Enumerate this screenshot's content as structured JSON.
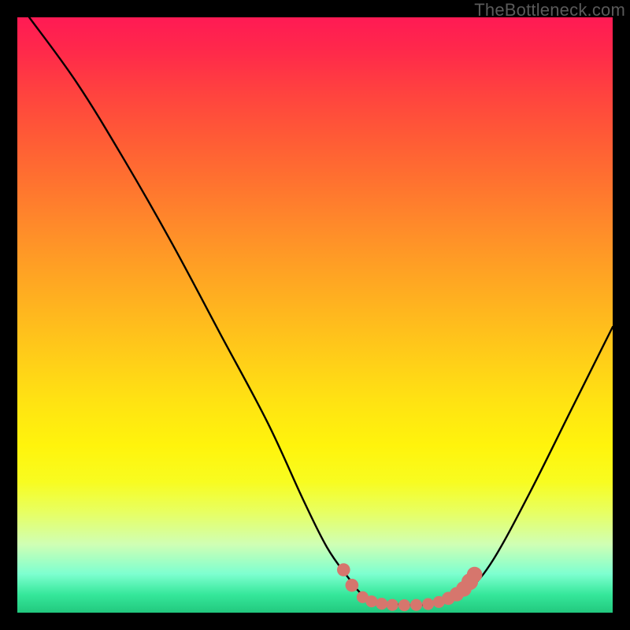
{
  "watermark": "TheBottleneck.com",
  "colors": {
    "background": "#000000",
    "curve_stroke": "#000000",
    "marker_fill": "#d6766d",
    "gradient_top": "#ff1a54",
    "gradient_bottom": "#22c87e"
  },
  "chart_data": {
    "type": "line",
    "title": "",
    "xlabel": "",
    "ylabel": "",
    "xlim": [
      0,
      100
    ],
    "ylim": [
      0,
      100
    ],
    "grid": false,
    "series": [
      {
        "name": "bottleneck-curve",
        "points": [
          {
            "x": 2,
            "y": 100
          },
          {
            "x": 10,
            "y": 89
          },
          {
            "x": 18,
            "y": 76
          },
          {
            "x": 26,
            "y": 62
          },
          {
            "x": 34,
            "y": 47
          },
          {
            "x": 42,
            "y": 32
          },
          {
            "x": 48,
            "y": 19
          },
          {
            "x": 52,
            "y": 11
          },
          {
            "x": 55.5,
            "y": 6
          },
          {
            "x": 58,
            "y": 3
          },
          {
            "x": 61,
            "y": 1.8
          },
          {
            "x": 65,
            "y": 1.3
          },
          {
            "x": 69,
            "y": 1.4
          },
          {
            "x": 73,
            "y": 2.4
          },
          {
            "x": 76,
            "y": 4
          },
          {
            "x": 80,
            "y": 9
          },
          {
            "x": 86,
            "y": 20
          },
          {
            "x": 93,
            "y": 34
          },
          {
            "x": 100,
            "y": 48
          }
        ]
      }
    ],
    "markers": [
      {
        "x": 54.8,
        "y": 7.2,
        "r": 1.1
      },
      {
        "x": 56.2,
        "y": 4.6,
        "r": 1.1
      },
      {
        "x": 58.0,
        "y": 2.6,
        "r": 1.0
      },
      {
        "x": 59.5,
        "y": 1.9,
        "r": 1.0
      },
      {
        "x": 61.2,
        "y": 1.5,
        "r": 1.0
      },
      {
        "x": 63.0,
        "y": 1.3,
        "r": 1.0
      },
      {
        "x": 65.0,
        "y": 1.25,
        "r": 1.0
      },
      {
        "x": 67.0,
        "y": 1.3,
        "r": 1.0
      },
      {
        "x": 69.0,
        "y": 1.45,
        "r": 1.0
      },
      {
        "x": 70.8,
        "y": 1.8,
        "r": 1.0
      },
      {
        "x": 72.4,
        "y": 2.4,
        "r": 1.1
      },
      {
        "x": 73.8,
        "y": 3.1,
        "r": 1.2
      },
      {
        "x": 75.0,
        "y": 4.0,
        "r": 1.3
      },
      {
        "x": 76.0,
        "y": 5.2,
        "r": 1.4
      },
      {
        "x": 76.8,
        "y": 6.4,
        "r": 1.3
      }
    ],
    "annotations": []
  }
}
